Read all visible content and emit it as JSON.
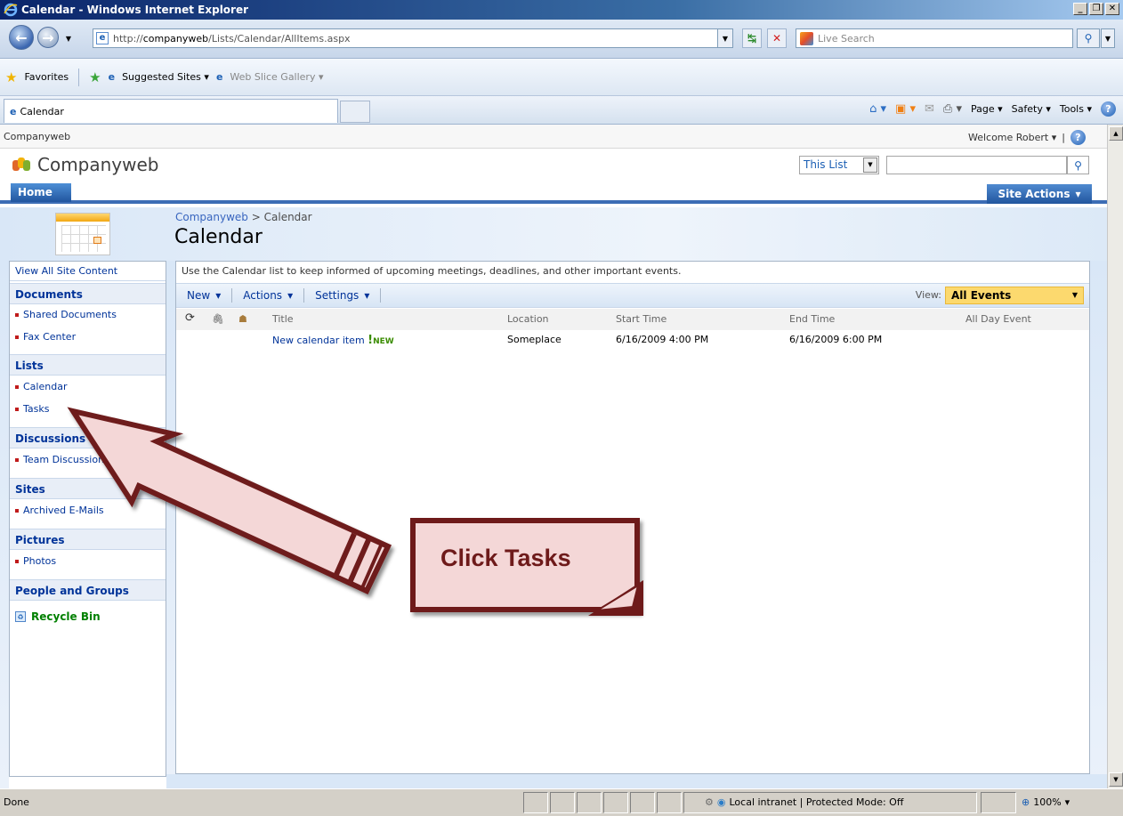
{
  "window": {
    "title": "Calendar - Windows Internet Explorer"
  },
  "address_bar": {
    "url_prefix": "http://",
    "url_domain": "companyweb",
    "url_path": "/Lists/Calendar/AllItems.aspx",
    "search_placeholder": "Live Search"
  },
  "favorites_bar": {
    "favorites_label": "Favorites",
    "suggested_sites": "Suggested Sites",
    "web_slice_gallery": "Web Slice Gallery"
  },
  "tabs": [
    {
      "label": "Calendar"
    }
  ],
  "command_bar": {
    "page": "Page",
    "safety": "Safety",
    "tools": "Tools"
  },
  "sharepoint": {
    "site_name_small": "Companyweb",
    "welcome": "Welcome Robert",
    "site_title": "Companyweb",
    "search_scope": "This List",
    "home_tab": "Home",
    "site_actions": "Site Actions",
    "breadcrumb_site": "Companyweb",
    "breadcrumb_sep": ">",
    "breadcrumb_page": "Calendar",
    "page_title": "Calendar"
  },
  "quick_launch": {
    "view_all": "View All Site Content",
    "sections": [
      {
        "heading": "Documents",
        "items": [
          "Shared Documents",
          "Fax Center"
        ]
      },
      {
        "heading": "Lists",
        "items": [
          "Calendar",
          "Tasks"
        ]
      },
      {
        "heading": "Discussions",
        "items": [
          "Team Discussion"
        ]
      },
      {
        "heading": "Sites",
        "items": [
          "Archived E-Mails"
        ]
      },
      {
        "heading": "Pictures",
        "items": [
          "Photos"
        ]
      },
      {
        "heading": "People and Groups",
        "items": []
      }
    ],
    "recycle_bin": "Recycle Bin"
  },
  "list": {
    "description": "Use the Calendar list to keep informed of upcoming meetings, deadlines, and other important events.",
    "toolbar": {
      "new": "New",
      "actions": "Actions",
      "settings": "Settings"
    },
    "view_label": "View:",
    "view_value": "All Events",
    "columns": [
      "Title",
      "Location",
      "Start Time",
      "End Time",
      "All Day Event"
    ],
    "rows": [
      {
        "title": "New calendar item",
        "new_flag": "NEW",
        "location": "Someplace",
        "start": "6/16/2009 4:00 PM",
        "end": "6/16/2009 6:00 PM",
        "all_day": ""
      }
    ]
  },
  "callout": {
    "text": "Click Tasks"
  },
  "status_bar": {
    "status": "Done",
    "zone": "Local intranet | Protected Mode: Off",
    "zoom": "100%"
  },
  "colors": {
    "callout_fill": "#f4d7d7",
    "callout_border": "#6e1a1a",
    "link_blue": "#003399",
    "site_actions_blue": "#21559e"
  }
}
